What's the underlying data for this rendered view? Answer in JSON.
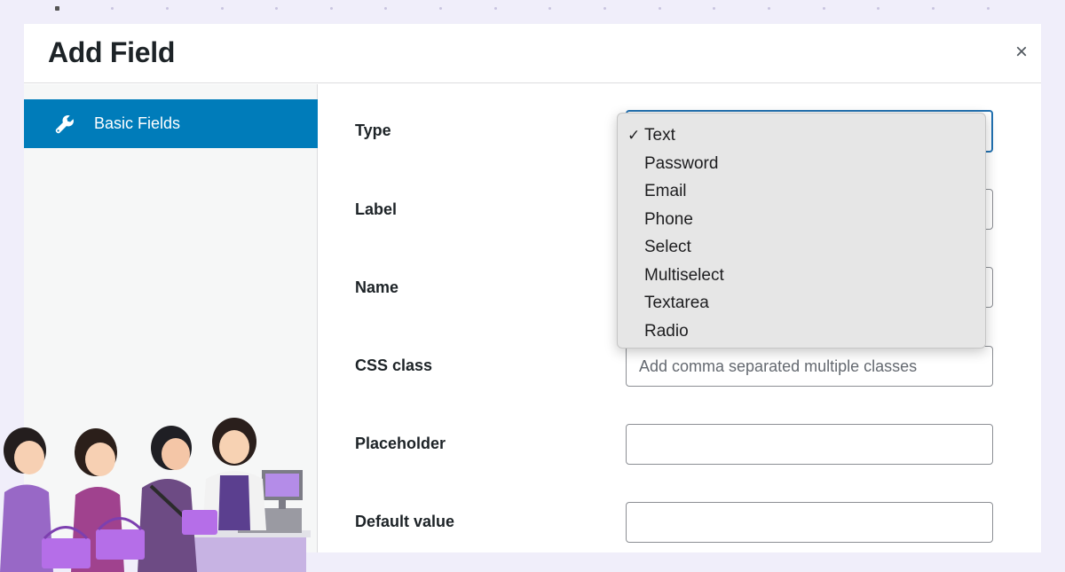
{
  "modal": {
    "title": "Add Field",
    "close_glyph": "×"
  },
  "sidebar": {
    "items": [
      {
        "label": "Basic Fields",
        "icon": "wrench-icon",
        "active": true
      }
    ]
  },
  "form": {
    "type_label": "Type",
    "label_label": "Label",
    "name_label": "Name",
    "css_label": "CSS class",
    "css_placeholder": "Add comma separated multiple classes",
    "placeholder_label": "Placeholder",
    "default_label": "Default value"
  },
  "dropdown": {
    "check_glyph": "✓",
    "selected": "Text",
    "options": [
      "Text",
      "Password",
      "Email",
      "Phone",
      "Select",
      "Multiselect",
      "Textarea",
      "Radio"
    ]
  },
  "colors": {
    "accent": "#007cba",
    "focus_border": "#2271b1",
    "background": "#f0eefa"
  }
}
